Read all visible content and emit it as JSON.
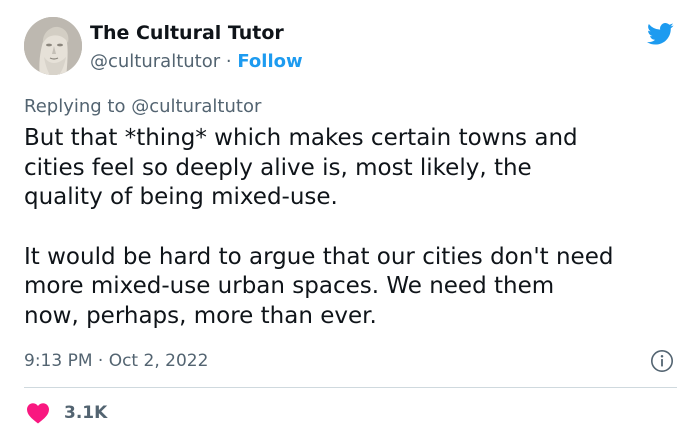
{
  "author": {
    "display_name": "The Cultural Tutor",
    "handle": "@culturaltutor",
    "separator": "·",
    "follow_label": "Follow"
  },
  "reply": {
    "prefix": "Replying to",
    "mention": "@culturaltutor"
  },
  "tweet": {
    "paragraphs": [
      "But that *thing* which makes certain towns and\ncities feel so deeply alive is, most likely, the\nquality of being mixed-use.",
      "It would be hard to argue that our cities don't need\nmore mixed-use urban spaces. We need them\nnow, perhaps, more than ever."
    ],
    "timestamp": "9:13 PM · Oct 2, 2022"
  },
  "engagement": {
    "likes": "3.1K"
  },
  "icons": {
    "brand": "twitter-bird-icon",
    "info": "info-icon",
    "like": "heart-icon",
    "avatar": "bust-avatar"
  },
  "colors": {
    "accent": "#1d9bf0",
    "like": "#f91880",
    "muted": "#536471",
    "text": "#0f1419",
    "divider": "#cfd9de"
  }
}
